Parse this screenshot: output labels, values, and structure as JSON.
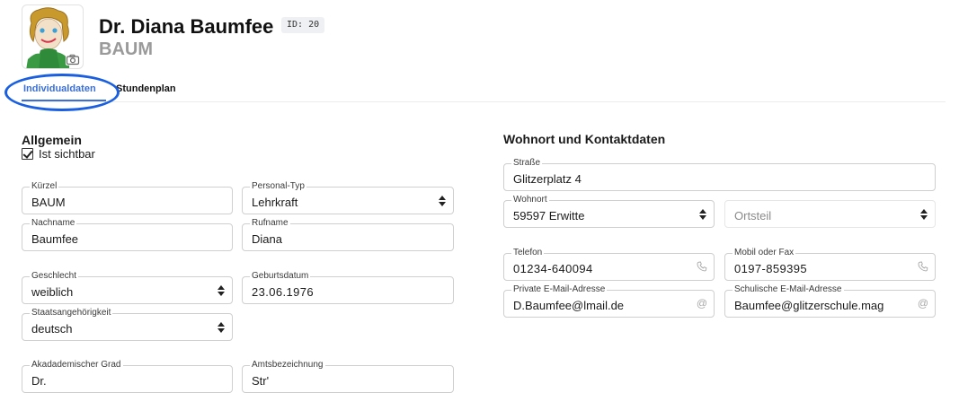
{
  "header": {
    "name": "Dr. Diana Baumfee",
    "id_badge": "ID: 20",
    "short_code": "BAUM"
  },
  "tabs": [
    {
      "label": "Individualdaten",
      "active": true
    },
    {
      "label": "Stundenplan",
      "active": false
    }
  ],
  "allgemein": {
    "title": "Allgemein",
    "visible_checkbox": {
      "label": "Ist sichtbar",
      "checked": true
    },
    "fields": {
      "kuerzel": {
        "label": "Kürzel",
        "value": "BAUM"
      },
      "personal_typ": {
        "label": "Personal-Typ",
        "value": "Lehrkraft"
      },
      "nachname": {
        "label": "Nachname",
        "value": "Baumfee"
      },
      "rufname": {
        "label": "Rufname",
        "value": "Diana"
      },
      "geschlecht": {
        "label": "Geschlecht",
        "value": "weiblich"
      },
      "geburtsdatum": {
        "label": "Geburtsdatum",
        "value": "23.06.1976"
      },
      "staatsangehoerigkeit": {
        "label": "Staatsangehörigkeit",
        "value": "deutsch"
      },
      "akad_grad": {
        "label": "Akadademischer Grad",
        "value": "Dr."
      },
      "amtsbezeichnung": {
        "label": "Amtsbezeichnung",
        "value": "Str'"
      }
    }
  },
  "kontakt": {
    "title": "Wohnort und Kontaktdaten",
    "fields": {
      "strasse": {
        "label": "Straße",
        "value": "Glitzerplatz 4"
      },
      "wohnort": {
        "label": "Wohnort",
        "value": "59597 Erwitte"
      },
      "ortsteil": {
        "placeholder": "Ortsteil"
      },
      "telefon": {
        "label": "Telefon",
        "value": "01234-640094"
      },
      "mobil": {
        "label": "Mobil oder Fax",
        "value": "0197-859395"
      },
      "email_privat": {
        "label": "Private E-Mail-Adresse",
        "value": "D.Baumfee@lmail.de"
      },
      "email_schule": {
        "label": "Schulische E-Mail-Adresse",
        "value": "Baumfee@glitzerschule.mag"
      }
    }
  },
  "icons": {
    "camera": "camera-icon",
    "phone": "phone-icon",
    "at": "at-icon",
    "stepper": "select-stepper-icon"
  },
  "colors": {
    "accent": "#3b6fd6",
    "highlight": "#1a5fe0"
  }
}
